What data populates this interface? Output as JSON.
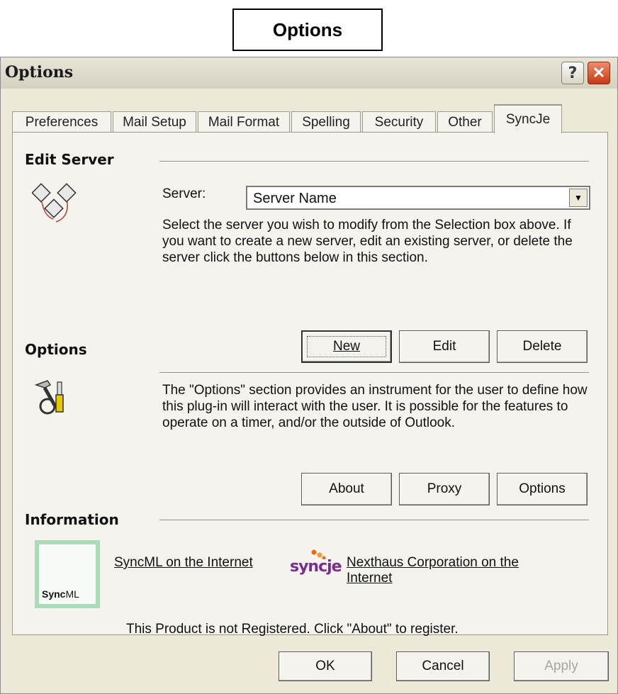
{
  "caption": "Options",
  "window": {
    "title": "Options",
    "help_glyph": "?",
    "close_glyph": "✕"
  },
  "tabs": [
    {
      "label": "Preferences"
    },
    {
      "label": "Mail Setup"
    },
    {
      "label": "Mail Format"
    },
    {
      "label": "Spelling"
    },
    {
      "label": "Security"
    },
    {
      "label": "Other"
    },
    {
      "label": "SyncJe"
    }
  ],
  "active_tab": "SyncJe",
  "edit_server": {
    "heading": "Edit Server",
    "server_label": "Server:",
    "server_value": "Server Name",
    "description": "Select the server you wish to modify from the Selection box above.  If you want to create a new server, edit an existing server, or delete the server click the buttons below in this section.",
    "buttons": {
      "new": "New",
      "edit": "Edit",
      "delete": "Delete"
    }
  },
  "options_section": {
    "heading": "Options",
    "description": "The \"Options\" section provides an instrument for the user to define how this plug-in will interact with the user.  It is possible for the features to operate on a timer, and/or the outside of Outlook.",
    "buttons": {
      "about": "About",
      "proxy": "Proxy",
      "options": "Options"
    }
  },
  "information": {
    "heading": "Information",
    "syncml_link": "SyncML on the Internet",
    "syncml_logo_bold": "Sync",
    "syncml_logo_rest": "ML",
    "syncje_logo": "syncje",
    "nexthaus_link_line1": "Nexthaus Corporation on the",
    "nexthaus_link_line2": "Internet",
    "registration_text": "This Product is not Registered.  Click \"About\" to register."
  },
  "dialog_buttons": {
    "ok": "OK",
    "cancel": "Cancel",
    "apply": "Apply"
  },
  "colors": {
    "close_button": "#c63a14",
    "syncml_border": "#a9dcb7",
    "syncje_purple": "#7b2d8e",
    "syncje_orange": "#e86a1c"
  }
}
